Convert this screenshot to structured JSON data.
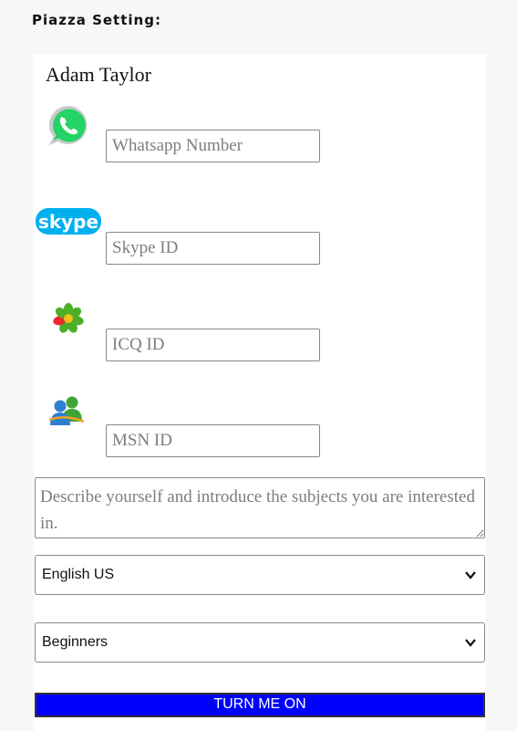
{
  "page": {
    "heading": "Piazza Setting:"
  },
  "profile": {
    "name": "Adam Taylor"
  },
  "fields": {
    "whatsapp": {
      "placeholder": "Whatsapp Number",
      "icon": "whatsapp-icon"
    },
    "skype": {
      "placeholder": "Skype ID",
      "icon": "skype-icon",
      "logo_text": "skype"
    },
    "icq": {
      "placeholder": "ICQ ID",
      "icon": "icq-icon"
    },
    "msn": {
      "placeholder": "MSN ID",
      "icon": "msn-icon"
    }
  },
  "description": {
    "placeholder": "Describe yourself and introduce the subjects you are interested in."
  },
  "language_select": {
    "value": "English US"
  },
  "level_select": {
    "value": "Beginners"
  },
  "submit": {
    "label": "TURN ME ON"
  },
  "colors": {
    "button_bg": "#0000ff",
    "whatsapp": "#25d366",
    "skype": "#00aff0"
  }
}
